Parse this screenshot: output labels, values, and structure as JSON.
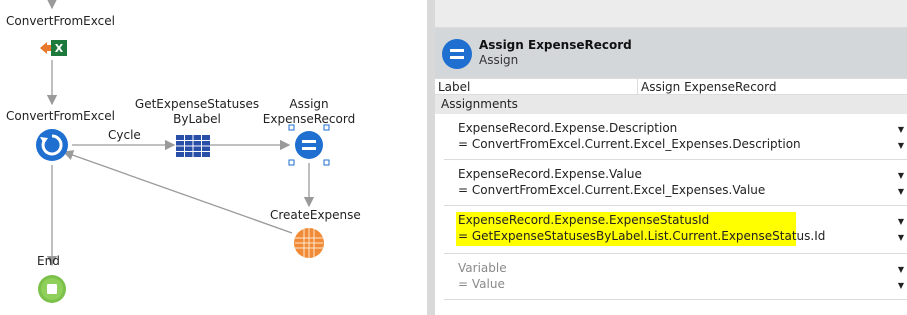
{
  "flow": {
    "top_node_label": "ConvertFromExcel",
    "loop_node_label": "ConvertFromExcel",
    "cycle_label": "Cycle",
    "aggregate_label_line1": "GetExpenseStatuses",
    "aggregate_label_line2": "ByLabel",
    "assign_label_line1": "Assign",
    "assign_label_line2": "ExpenseRecord",
    "create_label": "CreateExpense",
    "end_label": "End"
  },
  "properties": {
    "title": "Assign ExpenseRecord",
    "subtitle": "Assign",
    "label_key": "Label",
    "label_value": "Assign ExpenseRecord",
    "assignments_header": "Assignments",
    "assignments": [
      {
        "variable": "ExpenseRecord.Expense.Description",
        "value": "= ConvertFromExcel.Current.Excel_Expenses.Description",
        "highlighted": false
      },
      {
        "variable": "ExpenseRecord.Expense.Value",
        "value": "= ConvertFromExcel.Current.Excel_Expenses.Value",
        "highlighted": false
      },
      {
        "variable": "ExpenseRecord.Expense.ExpenseStatusId",
        "value": "= GetExpenseStatusesByLabel.List.Current.ExpenseStatus.Id",
        "highlighted": true
      },
      {
        "variable": "Variable",
        "value": "= Value",
        "highlighted": false,
        "placeholder": true
      }
    ],
    "dropdown_glyph": "▼"
  },
  "colors": {
    "assign_blue": "#1e6fd0",
    "excel_green": "#1d7a3c",
    "excel_orange": "#e8792c",
    "end_green": "#7cc14a",
    "create_orange": "#f08a36",
    "highlight": "#ffff00",
    "connector": "#9a9a9a"
  }
}
